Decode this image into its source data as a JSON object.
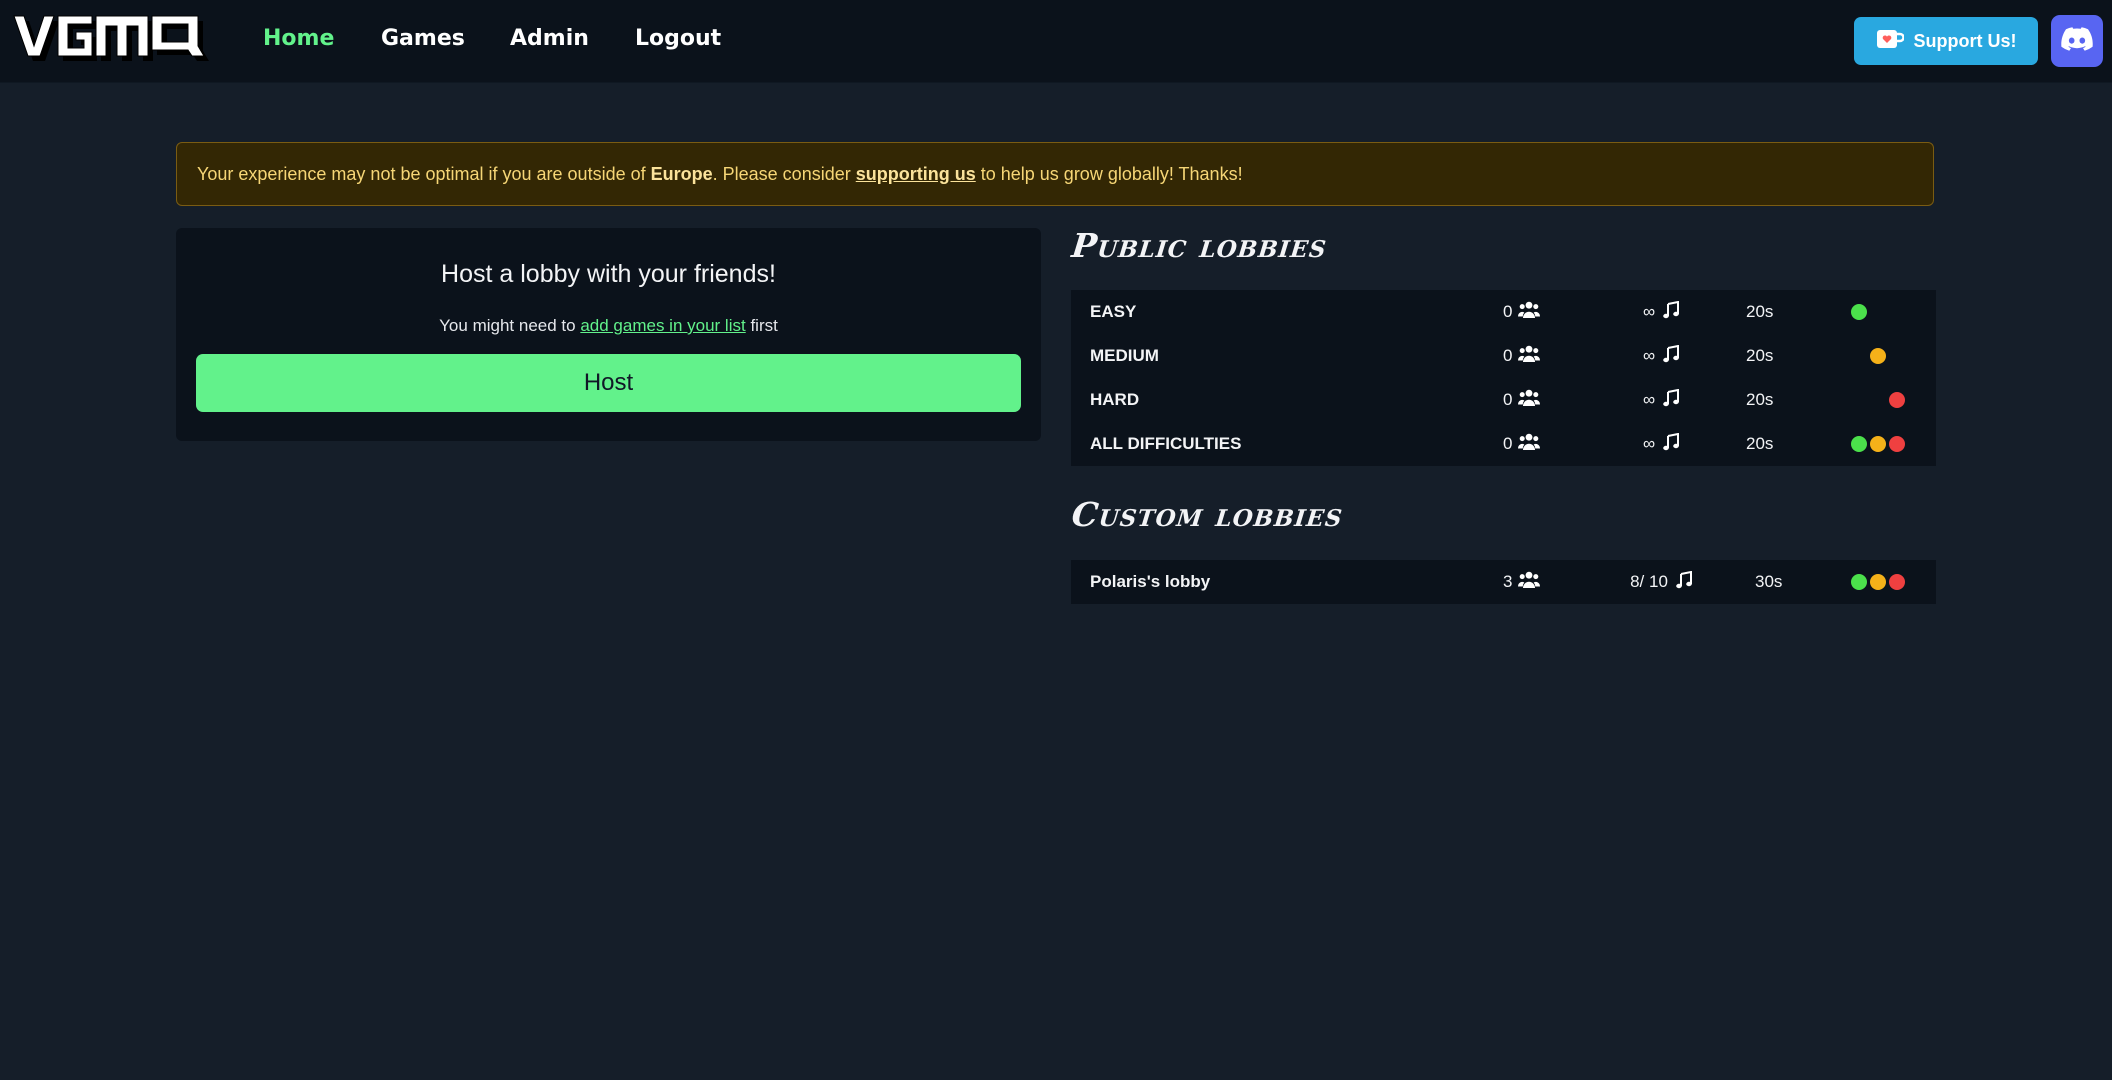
{
  "nav": {
    "logo_text": "VGMQ",
    "links": [
      "Home",
      "Games",
      "Admin",
      "Logout"
    ],
    "support_label": "Support Us!",
    "discord_icon": "discord-icon",
    "support_icon": "ko-fi-cup-icon"
  },
  "alert": {
    "prefix": "Your experience may not be optimal if you are outside of",
    "region": "Europe",
    "middle": ". Please consider",
    "link": "supporting us",
    "suffix": "to help us grow globally! Thanks!"
  },
  "host": {
    "title": "Host a lobby with your friends!",
    "hint_prefix": "You might need to",
    "hint_link": "add games in your list",
    "hint_suffix": "first",
    "button": "Host"
  },
  "public": {
    "title": "Public lobbies",
    "rows": [
      {
        "name": "EASY",
        "players": "0",
        "songs": "∞",
        "time": "20s",
        "difficulties": [
          "easy"
        ]
      },
      {
        "name": "MEDIUM",
        "players": "0",
        "songs": "∞",
        "time": "20s",
        "difficulties": [
          "medium"
        ]
      },
      {
        "name": "HARD",
        "players": "0",
        "songs": "∞",
        "time": "20s",
        "difficulties": [
          "hard"
        ]
      },
      {
        "name": "ALL DIFFICULTIES",
        "players": "0",
        "songs": "∞",
        "time": "20s",
        "difficulties": [
          "easy",
          "medium",
          "hard"
        ]
      }
    ]
  },
  "custom": {
    "title": "Custom lobbies",
    "rows": [
      {
        "name": "Polaris's lobby",
        "players": "3",
        "songs": "8/ 10",
        "time": "30s",
        "difficulties": [
          "easy",
          "medium",
          "hard"
        ]
      }
    ]
  },
  "colors": {
    "accent": "#62f28b",
    "easy": "#4be04b",
    "medium": "#f5b119",
    "hard": "#ef4040",
    "support": "#29a8e0",
    "discord": "#5865f2"
  }
}
